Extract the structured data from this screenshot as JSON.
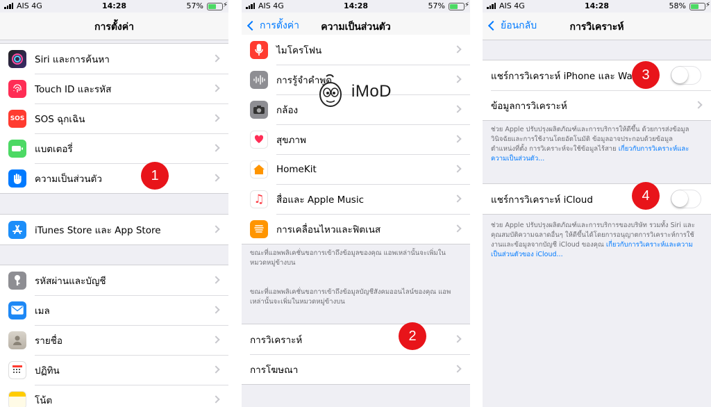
{
  "colors": {
    "accent": "#007aff",
    "badge": "#e8141a",
    "battery": "#4cd964"
  },
  "panels": {
    "settings": {
      "status": {
        "carrier": "AIS  4G",
        "time": "14:28",
        "battery": "57%",
        "battery_level": 0.57
      },
      "nav": {
        "title": "การตั้งค่า"
      },
      "group1": [
        {
          "label": "Siri และการค้นหา",
          "icon": "siri-icon",
          "color": "#1b1b2f"
        },
        {
          "label": "Touch ID และรหัส",
          "icon": "fingerprint-icon",
          "color": "#ff2d55"
        },
        {
          "label": "SOS ฉุกเฉิน",
          "icon": "sos-icon",
          "color": "#ff3b30",
          "icon_text": "SOS"
        },
        {
          "label": "แบตเตอรี่",
          "icon": "battery-icon",
          "color": "#4cd964"
        },
        {
          "label": "ความเป็นส่วนตัว",
          "icon": "hand-icon",
          "color": "#007aff"
        }
      ],
      "group2": [
        {
          "label": "iTunes Store และ App Store",
          "icon": "app-store-icon",
          "color": "#1c8ef9"
        }
      ],
      "group3": [
        {
          "label": "รหัสผ่านและบัญชี",
          "icon": "key-icon",
          "color": "#8e8e93"
        },
        {
          "label": "เมล",
          "icon": "mail-icon",
          "color": "#1e88f5"
        },
        {
          "label": "รายชื่อ",
          "icon": "contacts-icon",
          "color": "#c8c2b8"
        },
        {
          "label": "ปฏิทิน",
          "icon": "calendar-icon",
          "color": "#ffffff"
        },
        {
          "label": "โน้ต",
          "icon": "notes-icon",
          "color": "#ffcc00"
        }
      ],
      "badge": "1"
    },
    "privacy": {
      "status": {
        "carrier": "AIS  4G",
        "time": "14:28",
        "battery": "57%",
        "battery_level": 0.57
      },
      "nav": {
        "back": "การตั้งค่า",
        "title": "ความเป็นส่วนตัว"
      },
      "group1": [
        {
          "label": "ไมโครโฟน",
          "icon": "microphone-icon",
          "color": "#ff3b30"
        },
        {
          "label": "การรู้จำคำพูด",
          "icon": "speech-recognition-icon",
          "color": "#8e8e93"
        },
        {
          "label": "กล้อง",
          "icon": "camera-icon",
          "color": "#8e8e93"
        },
        {
          "label": "สุขภาพ",
          "icon": "health-icon",
          "color": "#ffffff"
        },
        {
          "label": "HomeKit",
          "icon": "home-icon",
          "color": "#ffffff"
        },
        {
          "label": "สื่อและ Apple Music",
          "icon": "music-icon",
          "color": "#ffffff"
        },
        {
          "label": "การเคลื่อนไหวและฟิตเนส",
          "icon": "motion-fitness-icon",
          "color": "#ff9500"
        }
      ],
      "footer1": "ขณะที่แอพพลิเคชั่นขอการเข้าถึงข้อมูลของคุณ แอพเหล่านั้นจะเพิ่มในหมวดหมู่ข้างบน",
      "footer2": "ขณะที่แอพพลิเคชั่นขอการเข้าถึงข้อมูลบัญชีสังคมออนไลน์ของคุณ แอพเหล่านั้นจะเพิ่มในหมวดหมู่ข้างบน",
      "group2": [
        {
          "label": "การวิเคราะห์"
        },
        {
          "label": "การโฆษณา"
        }
      ],
      "badge": "2"
    },
    "analytics": {
      "status": {
        "carrier": "AIS  4G",
        "time": "14:28",
        "battery": "58%",
        "battery_level": 0.58
      },
      "nav": {
        "back": "ย้อนกลับ",
        "title": "การวิเคราะห์"
      },
      "share_iphone": "แชร์การวิเคราะห์ iPhone และ Wa",
      "share_iphone_on": false,
      "analytics_data": "ข้อมูลการวิเคราะห์",
      "footer1": "ช่วย Apple ปรับปรุงผลิตภัณฑ์และการบริการให้ดีขึ้น ด้วยการส่งข้อมูลวินิจฉัยและการใช้งานโดยอัตโนมัติ ข้อมูลอาจประกอบด้วยข้อมูลตำแหน่งที่ตั้ง การวิเคราะห์จะใช้ข้อมูลไร้สาย",
      "footer1_link": "เกี่ยวกับการวิเคราะห์และความเป็นส่วนตัว...",
      "share_icloud": "แชร์การวิเคราะห์ iCloud",
      "share_icloud_on": false,
      "footer2": "ช่วย Apple ปรับปรุงผลิตภัณฑ์และการบริการของบริษัท รวมทั้ง Siri และคุณสมบัติความฉลาดอื่นๆ ให้ดีขึ้นได้โดยการอนุญาตการวิเคราะห์การใช้งานและข้อมูลจากบัญชี iCloud ของคุณ",
      "footer2_link": "เกี่ยวกับการวิเคราะห์และความเป็นส่วนตัวของ iCloud...",
      "badge3": "3",
      "badge4": "4"
    }
  },
  "watermark": {
    "text": "iMoD"
  }
}
